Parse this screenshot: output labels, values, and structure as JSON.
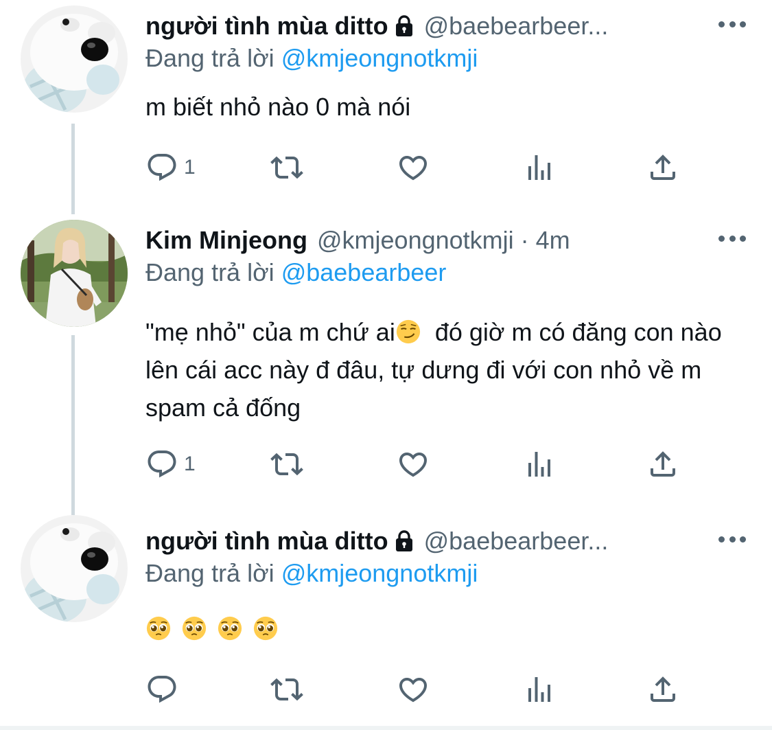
{
  "tweets": [
    {
      "name": "người tình mùa ditto",
      "handle": "@baebearbeer...",
      "replying_prefix": "Đang trả lời ",
      "replying_to": "@kmjeongnotkmji",
      "text": "m biết nhỏ nào 0 mà nói",
      "reply_count": "1",
      "avatar": "polar-bear-plush"
    },
    {
      "name": "Kim Minjeong",
      "handle": "@kmjeongnotkmji",
      "separator": "·",
      "time": "4m",
      "replying_prefix": "Đang trả lời ",
      "replying_to": "@baebearbeer",
      "text_part1": "\"mẹ nhỏ\" của m chứ ai",
      "text_emoji": "smirking-face-emoji",
      "text_part2": "  đó giờ m có đăng con nào lên cái acc này đ đâu, tự dưng đi với con nhỏ về m spam cả đống",
      "reply_count": "1",
      "avatar": "person-photo"
    },
    {
      "name": "người tình mùa ditto",
      "handle": "@baebearbeer...",
      "replying_prefix": "Đang trả lời ",
      "replying_to": "@kmjeongnotkmji",
      "emojis": [
        "pleading-face-emoji",
        "pleading-face-emoji",
        "pleading-face-emoji",
        "pleading-face-emoji"
      ],
      "reply_count": "",
      "avatar": "polar-bear-plush"
    }
  ],
  "icons": {
    "reply": "reply-icon",
    "retweet": "retweet-icon",
    "like": "like-icon",
    "views": "views-icon",
    "share": "share-icon",
    "more": "more-icon",
    "lock": "lock-icon"
  },
  "colors": {
    "text": "#0f1419",
    "secondary": "#536471",
    "link": "#1d9bf0",
    "thread_line": "#cfd9de"
  }
}
